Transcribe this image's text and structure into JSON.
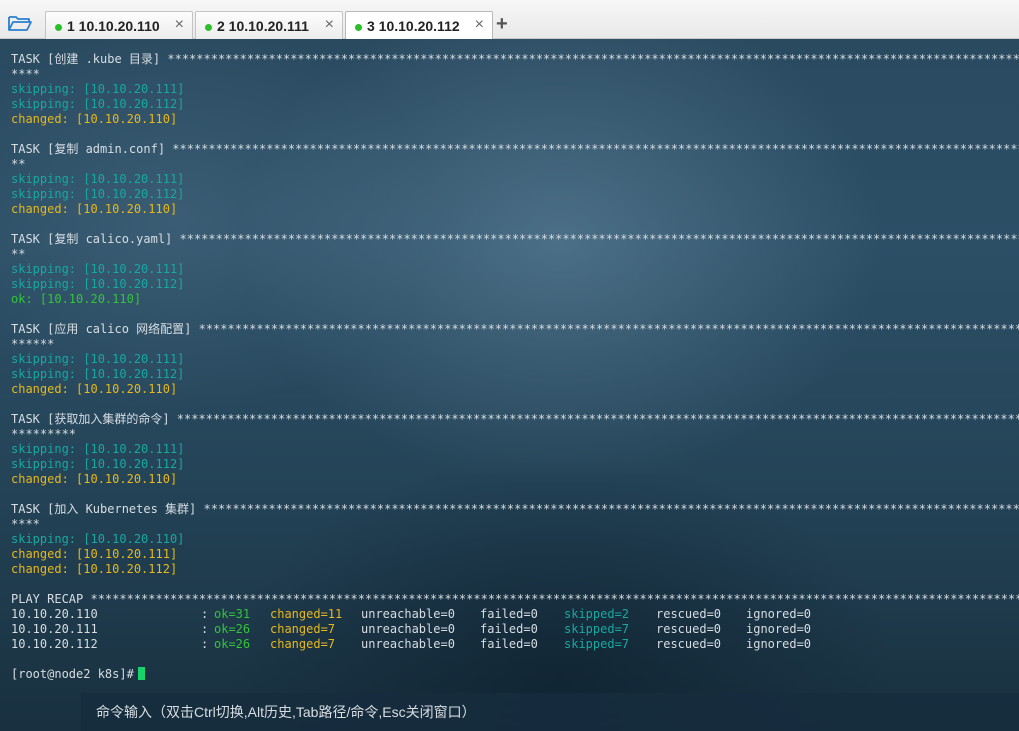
{
  "tabs": [
    {
      "label": "1 10.10.20.110",
      "close": "×",
      "status_color": "#2bbf2b"
    },
    {
      "label": "2 10.10.20.111",
      "close": "×",
      "status_color": "#2bbf2b"
    },
    {
      "label": "3 10.10.20.112",
      "close": "×",
      "status_color": "#2bbf2b",
      "active": true
    }
  ],
  "new_tab": "+",
  "terminal": {
    "tasks": [
      {
        "header": "TASK [创建 .kube 目录] *******************************************************************************************************************************",
        "stars": "****",
        "results": [
          [
            "skip",
            "skipping: [10.10.20.111]"
          ],
          [
            "skip",
            "skipping: [10.10.20.112]"
          ],
          [
            "chg",
            "changed: [10.10.20.110]"
          ]
        ]
      },
      {
        "header": "TASK [复制 admin.conf] *******************************************************************************************************************************",
        "stars": "**",
        "results": [
          [
            "skip",
            "skipping: [10.10.20.111]"
          ],
          [
            "skip",
            "skipping: [10.10.20.112]"
          ],
          [
            "chg",
            "changed: [10.10.20.110]"
          ]
        ]
      },
      {
        "header": "TASK [复制 calico.yaml] ******************************************************************************************************************************",
        "stars": "**",
        "results": [
          [
            "skip",
            "skipping: [10.10.20.111]"
          ],
          [
            "skip",
            "skipping: [10.10.20.112]"
          ],
          [
            "okc",
            "ok: [10.10.20.110]"
          ]
        ]
      },
      {
        "header": "TASK [应用 calico 网络配置] **************************************************************************************************************************",
        "stars": "******",
        "results": [
          [
            "skip",
            "skipping: [10.10.20.111]"
          ],
          [
            "skip",
            "skipping: [10.10.20.112]"
          ],
          [
            "chg",
            "changed: [10.10.20.110]"
          ]
        ]
      },
      {
        "header": "TASK [获取加入集群的命令] ****************************************************************************************************************************",
        "stars": "*********",
        "results": [
          [
            "skip",
            "skipping: [10.10.20.111]"
          ],
          [
            "skip",
            "skipping: [10.10.20.112]"
          ],
          [
            "chg",
            "changed: [10.10.20.110]"
          ]
        ]
      },
      {
        "header": "TASK [加入 Kubernetes 集群] *************************************************************************************************************************",
        "stars": "****",
        "results": [
          [
            "skip",
            "skipping: [10.10.20.110]"
          ],
          [
            "chg",
            "changed: [10.10.20.111]"
          ],
          [
            "chg",
            "changed: [10.10.20.112]"
          ]
        ]
      }
    ],
    "recap_header": "PLAY RECAP ***************************************************************************************************************************************",
    "recap": [
      {
        "host": "10.10.20.110",
        "sep": ":",
        "ok": "ok=31",
        "changed": "changed=11",
        "unreachable": "unreachable=0",
        "failed": "failed=0",
        "skipped": "skipped=2",
        "rescued": "rescued=0",
        "ignored": "ignored=0"
      },
      {
        "host": "10.10.20.111",
        "sep": ":",
        "ok": "ok=26",
        "changed": "changed=7",
        "unreachable": "unreachable=0",
        "failed": "failed=0",
        "skipped": "skipped=7",
        "rescued": "rescued=0",
        "ignored": "ignored=0"
      },
      {
        "host": "10.10.20.112",
        "sep": ":",
        "ok": "ok=26",
        "changed": "changed=7",
        "unreachable": "unreachable=0",
        "failed": "failed=0",
        "skipped": "skipped=7",
        "rescued": "rescued=0",
        "ignored": "ignored=0"
      }
    ],
    "prompt": "[root@node2 k8s]#",
    "cursor_color": "#16d46a",
    "command_hint": "命令输入（双击Ctrl切换,Alt历史,Tab路径/命令,Esc关闭窗口）"
  },
  "colors": {
    "skipping": "#18a8a0",
    "changed": "#e8b81c",
    "ok": "#33c43a",
    "text": "#d7dde2"
  }
}
